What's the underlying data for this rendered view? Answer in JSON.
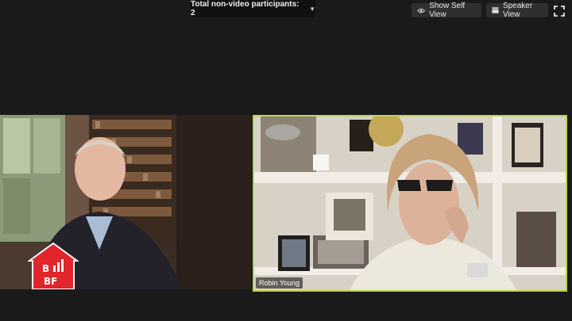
{
  "header": {
    "participants_label": "Total non-video participants: 2",
    "dropdown_icon": "chevron-down-icon"
  },
  "toolbar": {
    "show_self_view": "Show Self View",
    "speaker_view": "Speaker View",
    "fullscreen_icon": "fullscreen-icon"
  },
  "tiles": [
    {
      "name": "",
      "logo_text_top": "B",
      "logo_text_bottom": "BF"
    },
    {
      "name": "Robin Young"
    }
  ],
  "colors": {
    "active_speaker_border": "#b6d84a",
    "logo_red": "#e0262a"
  }
}
